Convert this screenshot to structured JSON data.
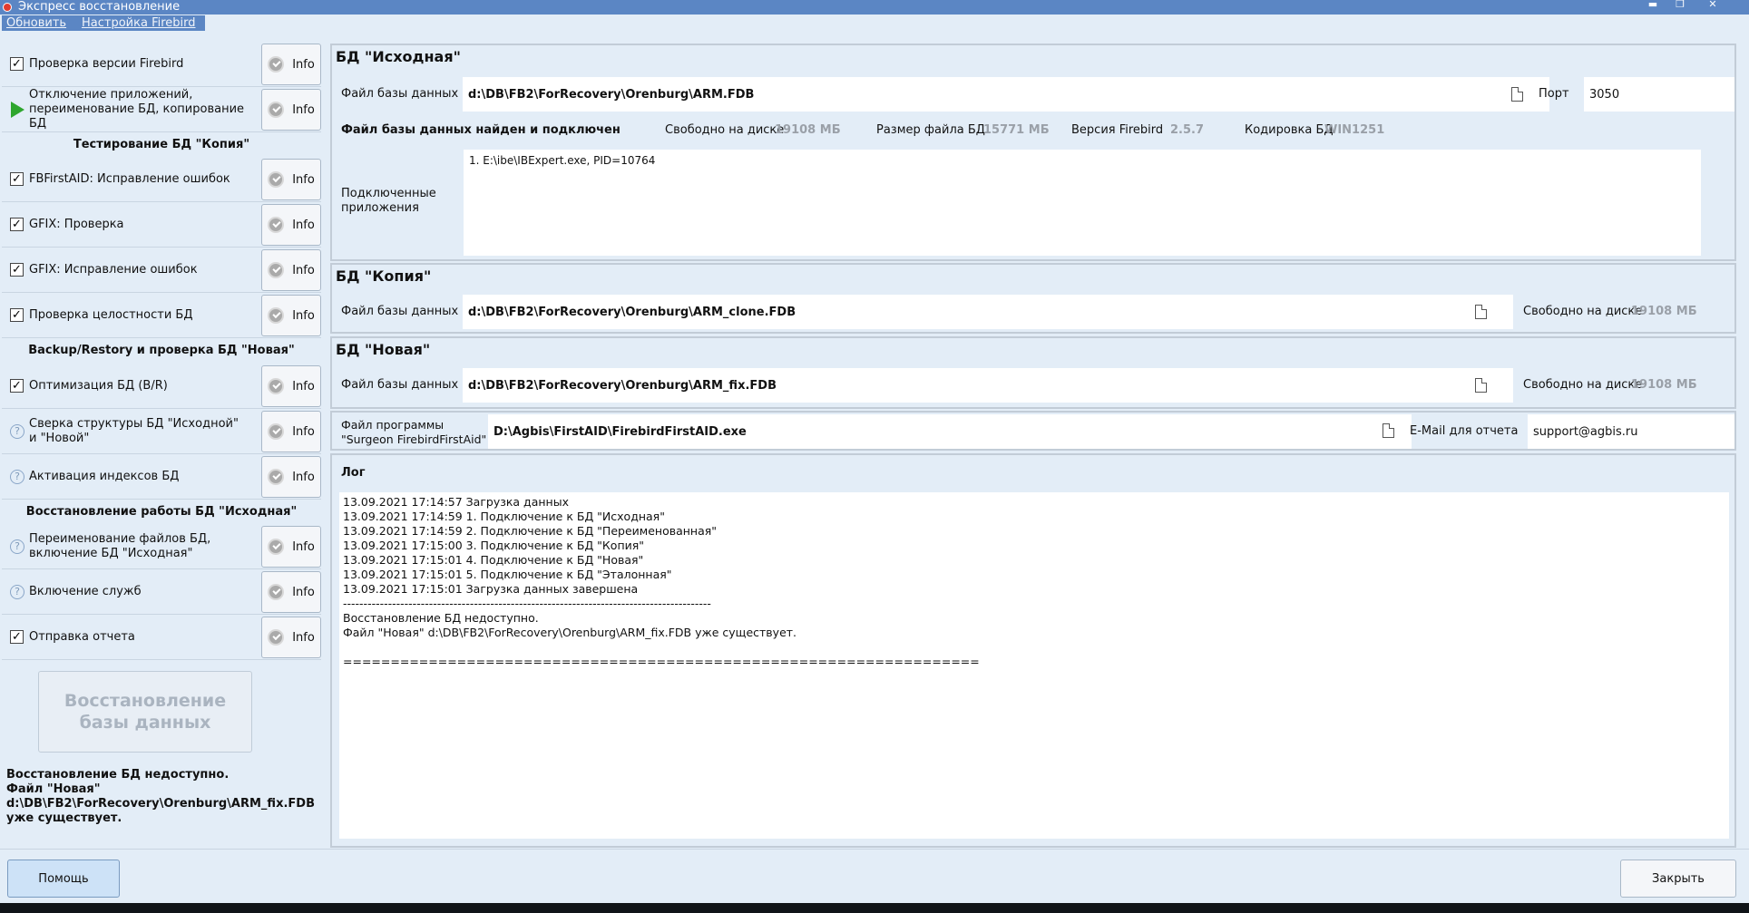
{
  "window": {
    "title": "Экспресс восстановление",
    "controls": [
      "minimize",
      "maximize",
      "close"
    ]
  },
  "menu": [
    "Обновить",
    "Настройка Firebird"
  ],
  "left": {
    "steps_group1": [
      {
        "label": "Проверка версии Firebird",
        "marker": "checked",
        "info": "Info"
      },
      {
        "label": "Отключение приложений, переименование БД, копирование БД",
        "marker": "play",
        "info": "Info"
      }
    ],
    "section1": "Тестирование БД \"Копия\"",
    "steps_group2": [
      {
        "label": "FBFirstAID: Исправление ошибок",
        "marker": "checked",
        "info": "Info"
      },
      {
        "label": "GFIX: Проверка",
        "marker": "checked",
        "info": "Info"
      },
      {
        "label": "GFIX: Исправление ошибок",
        "marker": "checked",
        "info": "Info"
      },
      {
        "label": "Проверка целостности БД",
        "marker": "checked",
        "info": "Info"
      }
    ],
    "section2": "Backup/Restory и проверка БД \"Новая\"",
    "steps_group3": [
      {
        "label": "Оптимизация БД (B/R)",
        "marker": "checked",
        "info": "Info"
      },
      {
        "label": "Сверка структуры БД \"Исходной\" и \"Новой\"",
        "marker": "question",
        "info": "Info"
      },
      {
        "label": "Активация индексов БД",
        "marker": "question",
        "info": "Info"
      }
    ],
    "section3": "Восстановление работы БД \"Исходная\"",
    "steps_group4": [
      {
        "label": "Переименование файлов БД, включение БД \"Исходная\"",
        "marker": "question",
        "info": "Info"
      },
      {
        "label": "Включение служб",
        "marker": "question",
        "info": "Info"
      },
      {
        "label": "Отправка отчета",
        "marker": "checked",
        "info": "Info"
      }
    ],
    "restore_button": "Восстановление базы данных",
    "status_text": "Восстановление БД недоступно.\nФайл \"Новая\"\nd:\\DB\\FB2\\ForRecovery\\Orenburg\\ARM_fix.FDB\nуже существует."
  },
  "source_db": {
    "title": "БД \"Исходная\"",
    "file_label": "Файл базы данных",
    "file_value": "d:\\DB\\FB2\\ForRecovery\\Orenburg\\ARM.FDB",
    "port_label": "Порт",
    "port_value": "3050",
    "status": "Файл базы данных найден и подключен",
    "free_disk_label": "Свободно на диске",
    "free_disk_value": "19108 МБ",
    "file_size_label": "Размер файла  БД",
    "file_size_value": "15771 МБ",
    "fb_version_label": "Версия Firebird",
    "fb_version_value": "2.5.7",
    "encoding_label": "Кодировка БД",
    "encoding_value": "WIN1251",
    "connected_label": "Подключенные\nприложения",
    "connected_apps": "1. E:\\ibe\\IBExpert.exe, PID=10764"
  },
  "copy_db": {
    "title": "БД \"Копия\"",
    "file_label": "Файл базы данных",
    "file_value": "d:\\DB\\FB2\\ForRecovery\\Orenburg\\ARM_clone.FDB",
    "free_disk_label": "Свободно на диске",
    "free_disk_value": "19108 МБ"
  },
  "new_db": {
    "title": "БД \"Новая\"",
    "file_label": "Файл базы данных",
    "file_value": "d:\\DB\\FB2\\ForRecovery\\Orenburg\\ARM_fix.FDB",
    "free_disk_label": "Свободно на диске",
    "free_disk_value": "19108 МБ"
  },
  "program": {
    "label": "Файл программы\n\"Surgeon FirebirdFirstAid\"",
    "value": "D:\\Agbis\\FirstAID\\FirebirdFirstAID.exe",
    "email_label": "E-Mail для отчета",
    "email_value": "support@agbis.ru"
  },
  "log": {
    "title": "Лог",
    "text": "13.09.2021 17:14:57 Загрузка данных\n13.09.2021 17:14:59 1. Подключение к БД \"Исходная\"\n13.09.2021 17:14:59 2. Подключение к БД \"Переименованная\"\n13.09.2021 17:15:00 3. Подключение к БД \"Копия\"\n13.09.2021 17:15:01 4. Подключение к БД \"Новая\"\n13.09.2021 17:15:01 5. Подключение к БД \"Эталонная\"\n13.09.2021 17:15:01 Загрузка данных завершена\n------------------------------------------------------------------------------------------\nВосстановление БД недоступно.\nФайл \"Новая\" d:\\DB\\FB2\\ForRecovery\\Orenburg\\ARM_fix.FDB уже существует.\n\n==================================================================="
  },
  "bottom": {
    "help": "Помощь",
    "close": "Закрыть"
  }
}
